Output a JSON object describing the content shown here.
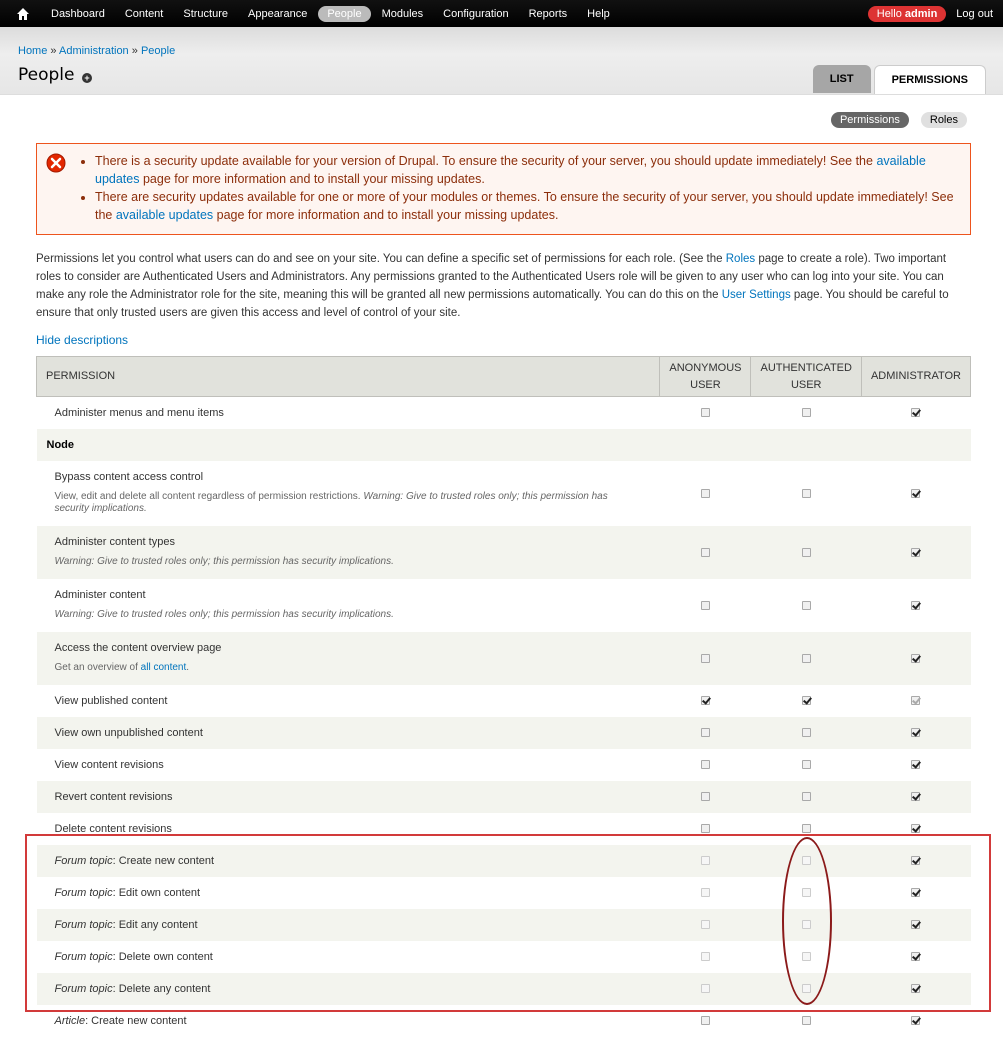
{
  "toolbar": {
    "items": [
      "Dashboard",
      "Content",
      "Structure",
      "Appearance",
      "People",
      "Modules",
      "Configuration",
      "Reports",
      "Help"
    ],
    "active": "People",
    "hello_prefix": "Hello",
    "user": "admin",
    "logout": "Log out"
  },
  "breadcrumb": [
    "Home",
    "Administration",
    "People"
  ],
  "breadcrumb_sep": "»",
  "page_title": "People",
  "tabs": {
    "list": "List",
    "permissions": "Permissions"
  },
  "subtabs": {
    "permissions": "Permissions",
    "roles": "Roles"
  },
  "messages": {
    "m1_before": "There is a security update available for your version of Drupal. To ensure the security of your server, you should update immediately! See the ",
    "m1_link": "available updates",
    "m1_after": " page for more information and to install your missing updates.",
    "m2_before": "There are security updates available for one or more of your modules or themes. To ensure the security of your server, you should update immediately! See the ",
    "m2_link": "available updates",
    "m2_after": " page for more information and to install your missing updates."
  },
  "description": {
    "p1": "Permissions let you control what users can do and see on your site. You can define a specific set of permissions for each role. (See the ",
    "roles_link": "Roles",
    "p2": " page to create a role). Two important roles to consider are Authenticated Users and Administrators. Any permissions granted to the Authenticated Users role will be given to any user who can log into your site. You can make any role the Administrator role for the site, meaning this will be granted all new permissions automatically. You can do this on the ",
    "settings_link": "User Settings",
    "p3": " page. You should be careful to ensure that only trusted users are given this access and level of control of your site."
  },
  "hide_descriptions": "Hide descriptions",
  "table": {
    "headers": {
      "permission": "Permission",
      "anon": "Anonymous user",
      "auth": "Authenticated user",
      "admin": "Administrator"
    },
    "module_node": "Node",
    "rows": [
      {
        "type": "perm",
        "prefix": "",
        "title": "Administer menus and menu items",
        "desc": "",
        "warn": "",
        "anon": false,
        "auth": false,
        "admin": true,
        "adminDim": false,
        "authDisabled": false,
        "height": 32
      },
      {
        "type": "module",
        "title": "Node",
        "height": 32
      },
      {
        "type": "perm",
        "prefix": "",
        "title": "Bypass content access control",
        "desc": "View, edit and delete all content regardless of permission restrictions. ",
        "warn": "Warning: Give to trusted roles only; this permission has security implications.",
        "anon": false,
        "auth": false,
        "admin": true,
        "adminDim": false,
        "authDisabled": false,
        "height": 65
      },
      {
        "type": "perm",
        "prefix": "",
        "title": "Administer content types",
        "desc": "",
        "warn": "Warning: Give to trusted roles only; this permission has security implications.",
        "anon": false,
        "auth": false,
        "admin": true,
        "adminDim": false,
        "authDisabled": false,
        "height": 53
      },
      {
        "type": "perm",
        "prefix": "",
        "title": "Administer content",
        "desc": "",
        "warn": "Warning: Give to trusted roles only; this permission has security implications.",
        "anon": false,
        "auth": false,
        "admin": true,
        "adminDim": false,
        "authDisabled": false,
        "height": 53
      },
      {
        "type": "perm",
        "prefix": "",
        "title": "Access the content overview page",
        "desc": "Get an overview of ",
        "desc_link": "all content",
        "warn": "",
        "anon": false,
        "auth": false,
        "admin": true,
        "adminDim": false,
        "authDisabled": false,
        "height": 53
      },
      {
        "type": "perm",
        "prefix": "",
        "title": "View published content",
        "desc": "",
        "warn": "",
        "anon": true,
        "auth": true,
        "admin": true,
        "adminDim": true,
        "authDisabled": false,
        "height": 32
      },
      {
        "type": "perm",
        "prefix": "",
        "title": "View own unpublished content",
        "desc": "",
        "warn": "",
        "anon": false,
        "auth": false,
        "admin": true,
        "adminDim": false,
        "authDisabled": false,
        "height": 32
      },
      {
        "type": "perm",
        "prefix": "",
        "title": "View content revisions",
        "desc": "",
        "warn": "",
        "anon": false,
        "auth": false,
        "admin": true,
        "adminDim": false,
        "authDisabled": false,
        "height": 32
      },
      {
        "type": "perm",
        "prefix": "",
        "title": "Revert content revisions",
        "desc": "",
        "warn": "",
        "anon": false,
        "auth": false,
        "admin": true,
        "adminDim": false,
        "authDisabled": false,
        "height": 32
      },
      {
        "type": "perm",
        "prefix": "",
        "title": "Delete content revisions",
        "desc": "",
        "warn": "",
        "anon": false,
        "auth": false,
        "admin": true,
        "adminDim": false,
        "authDisabled": false,
        "height": 32
      },
      {
        "type": "perm",
        "prefix": "Forum topic",
        "title": ": Create new content",
        "desc": "",
        "warn": "",
        "anon": false,
        "auth": false,
        "admin": true,
        "adminDim": false,
        "authDisabled": true,
        "height": 32
      },
      {
        "type": "perm",
        "prefix": "Forum topic",
        "title": ": Edit own content",
        "desc": "",
        "warn": "",
        "anon": false,
        "auth": false,
        "admin": true,
        "adminDim": false,
        "authDisabled": true,
        "height": 32
      },
      {
        "type": "perm",
        "prefix": "Forum topic",
        "title": ": Edit any content",
        "desc": "",
        "warn": "",
        "anon": false,
        "auth": false,
        "admin": true,
        "adminDim": false,
        "authDisabled": true,
        "height": 32
      },
      {
        "type": "perm",
        "prefix": "Forum topic",
        "title": ": Delete own content",
        "desc": "",
        "warn": "",
        "anon": false,
        "auth": false,
        "admin": true,
        "adminDim": false,
        "authDisabled": true,
        "height": 32
      },
      {
        "type": "perm",
        "prefix": "Forum topic",
        "title": ": Delete any content",
        "desc": "",
        "warn": "",
        "anon": false,
        "auth": false,
        "admin": true,
        "adminDim": false,
        "authDisabled": true,
        "height": 32
      },
      {
        "type": "perm",
        "prefix": "Article",
        "title": ": Create new content",
        "desc": "",
        "warn": "",
        "anon": false,
        "auth": false,
        "admin": true,
        "adminDim": false,
        "authDisabled": false,
        "height": 32
      }
    ]
  },
  "colors": {
    "error_border": "#ed541d",
    "error_bg": "#fef5f1",
    "error_text": "#8c2e0b",
    "annotation_red": "#d23a3a",
    "annotation_dark_red": "#8b1a1a",
    "link": "#0074bd"
  }
}
